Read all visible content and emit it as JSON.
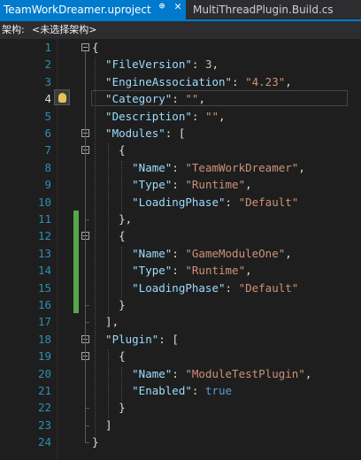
{
  "tabs": [
    {
      "label": "TeamWorkDreamer.uproject",
      "active": true,
      "pin_icon": "pin-icon",
      "close_icon": "close-icon"
    },
    {
      "label": "MultiThreadPlugin.Build.cs",
      "active": false
    }
  ],
  "navbar": {
    "label": "架构:",
    "value": "<未选择架构>"
  },
  "editor": {
    "line_numbers": [
      "1",
      "2",
      "3",
      "4",
      "5",
      "6",
      "7",
      "8",
      "9",
      "10",
      "11",
      "12",
      "13",
      "14",
      "15",
      "16",
      "17",
      "18",
      "19",
      "20",
      "21",
      "22",
      "23",
      "24"
    ],
    "current_line": "4",
    "lines": [
      [
        [
          "p",
          "{"
        ]
      ],
      [
        [
          "k",
          "  \"FileVersion\""
        ],
        [
          "p",
          ": "
        ],
        [
          "n",
          "3"
        ],
        [
          "p",
          ","
        ]
      ],
      [
        [
          "k",
          "  \"EngineAssociation\""
        ],
        [
          "p",
          ": "
        ],
        [
          "s",
          "\"4.23\""
        ],
        [
          "p",
          ","
        ]
      ],
      [
        [
          "k",
          "  \"Category\""
        ],
        [
          "p",
          ": "
        ],
        [
          "s",
          "\"\""
        ],
        [
          "p",
          ","
        ]
      ],
      [
        [
          "k",
          "  \"Description\""
        ],
        [
          "p",
          ": "
        ],
        [
          "s",
          "\"\""
        ],
        [
          "p",
          ","
        ]
      ],
      [
        [
          "k",
          "  \"Modules\""
        ],
        [
          "p",
          ": ["
        ]
      ],
      [
        [
          "p",
          "    {"
        ]
      ],
      [
        [
          "k",
          "      \"Name\""
        ],
        [
          "p",
          ": "
        ],
        [
          "s",
          "\"TeamWorkDreamer\""
        ],
        [
          "p",
          ","
        ]
      ],
      [
        [
          "k",
          "      \"Type\""
        ],
        [
          "p",
          ": "
        ],
        [
          "s",
          "\"Runtime\""
        ],
        [
          "p",
          ","
        ]
      ],
      [
        [
          "k",
          "      \"LoadingPhase\""
        ],
        [
          "p",
          ": "
        ],
        [
          "s",
          "\"Default\""
        ]
      ],
      [
        [
          "p",
          "    },"
        ]
      ],
      [
        [
          "p",
          "    {"
        ]
      ],
      [
        [
          "k",
          "      \"Name\""
        ],
        [
          "p",
          ": "
        ],
        [
          "s",
          "\"GameModuleOne\""
        ],
        [
          "p",
          ","
        ]
      ],
      [
        [
          "k",
          "      \"Type\""
        ],
        [
          "p",
          ": "
        ],
        [
          "s",
          "\"Runtime\""
        ],
        [
          "p",
          ","
        ]
      ],
      [
        [
          "k",
          "      \"LoadingPhase\""
        ],
        [
          "p",
          ": "
        ],
        [
          "s",
          "\"Default\""
        ]
      ],
      [
        [
          "p",
          "    }"
        ]
      ],
      [
        [
          "p",
          "  ],"
        ]
      ],
      [
        [
          "k",
          "  \"Plugin\""
        ],
        [
          "p",
          ": ["
        ]
      ],
      [
        [
          "p",
          "    {"
        ]
      ],
      [
        [
          "k",
          "      \"Name\""
        ],
        [
          "p",
          ": "
        ],
        [
          "s",
          "\"ModuleTestPlugin\""
        ],
        [
          "p",
          ","
        ]
      ],
      [
        [
          "k",
          "      \"Enabled\""
        ],
        [
          "p",
          ": "
        ],
        [
          "b",
          "true"
        ]
      ],
      [
        [
          "p",
          "    }"
        ]
      ],
      [
        [
          "p",
          "  ]"
        ]
      ],
      [
        [
          "p",
          "}"
        ]
      ]
    ],
    "lightbulb_icon": "lightbulb-icon"
  },
  "colors": {
    "property": "#9cdcfe",
    "string": "#ce9178",
    "number": "#b5cea8",
    "keyword": "#569cd6",
    "line_number": "#2b91af",
    "changed_marker": "#57a64a"
  }
}
